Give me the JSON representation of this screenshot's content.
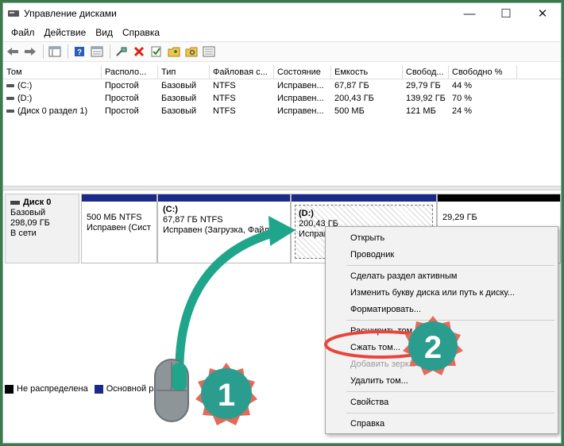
{
  "window": {
    "title": "Управление дисками",
    "controls": [
      "—",
      "☐",
      "✕"
    ]
  },
  "menu": [
    "Файл",
    "Действие",
    "Вид",
    "Справка"
  ],
  "toolbar": {
    "icons": [
      "back-arrow-icon",
      "forward-arrow-icon",
      "console-tree-icon",
      "help-icon",
      "properties-icon",
      "connect-icon",
      "delete-icon",
      "check-icon",
      "new-folder-icon",
      "search-folder-icon",
      "list-view-icon"
    ]
  },
  "volumes": {
    "columns": [
      "Том",
      "Располо...",
      "Тип",
      "Файловая с...",
      "Состояние",
      "Емкость",
      "Свобод...",
      "Свободно %"
    ],
    "rows": [
      [
        "(C:)",
        "Простой",
        "Базовый",
        "NTFS",
        "Исправен...",
        "67,87 ГБ",
        "29,79 ГБ",
        "44 %"
      ],
      [
        "(D:)",
        "Простой",
        "Базовый",
        "NTFS",
        "Исправен...",
        "200,43 ГБ",
        "139,92 ГБ",
        "70 %"
      ],
      [
        "(Диск 0 раздел 1)",
        "Простой",
        "Базовый",
        "NTFS",
        "Исправен...",
        "500 МБ",
        "121 МБ",
        "24 %"
      ]
    ]
  },
  "disk": {
    "name": "Диск 0",
    "type": "Базовый",
    "size": "298,09 ГБ",
    "status": "В сети",
    "partitions": [
      {
        "label": "",
        "size": "500 МБ NTFS",
        "status": "Исправен (Сист"
      },
      {
        "label": "(C:)",
        "size": "67,87 ГБ NTFS",
        "status": "Исправен (Загрузка, Файл"
      },
      {
        "label": "(D:)",
        "size": "200,43 ГБ",
        "status": "Исправ"
      },
      {
        "label": "",
        "size": "29,29 ГБ",
        "status": ""
      }
    ]
  },
  "legend": [
    {
      "label": "Не распределена",
      "color": "#000000"
    },
    {
      "label": "Основной разд",
      "color": "#1a2a8a"
    }
  ],
  "context_menu": {
    "items": [
      {
        "label": "Открыть",
        "enabled": true
      },
      {
        "label": "Проводник",
        "enabled": true
      },
      {
        "label": "Сделать раздел активным",
        "enabled": true
      },
      {
        "label": "Изменить букву диска или путь к диску...",
        "enabled": true
      },
      {
        "label": "Форматировать...",
        "enabled": true
      },
      {
        "label": "Расширить том...",
        "enabled": true
      },
      {
        "label": "Сжать том...",
        "enabled": true
      },
      {
        "label": "Добавить зеркало...",
        "enabled": false
      },
      {
        "label": "Удалить том...",
        "enabled": true
      },
      {
        "label": "Свойства",
        "enabled": true
      },
      {
        "label": "Справка",
        "enabled": true
      }
    ]
  },
  "annotations": {
    "step1": "1",
    "step2": "2",
    "arrow_color": "#1fa58a",
    "badge_color": "#2a9d8f",
    "badge_border": "#e36a5a",
    "highlight_color": "#e8463c"
  }
}
